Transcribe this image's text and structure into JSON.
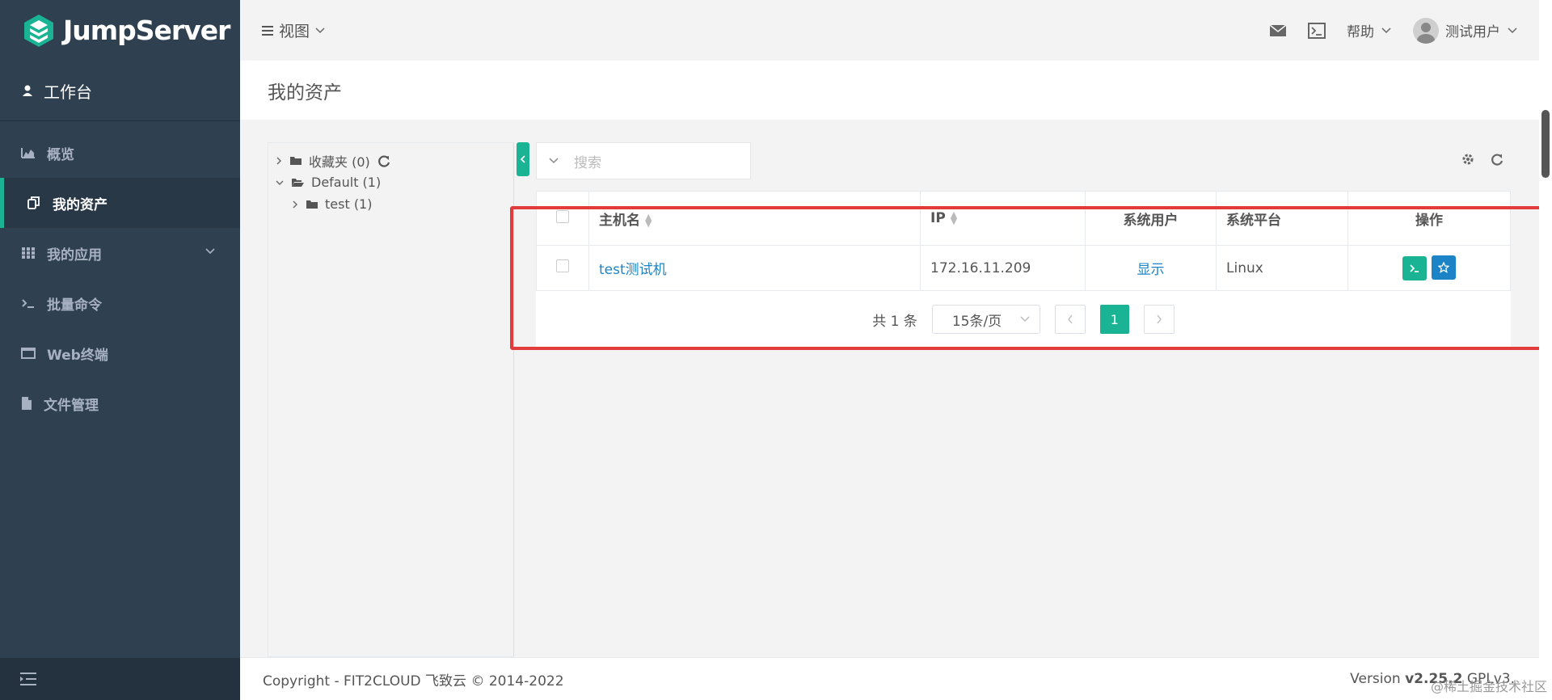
{
  "sidebar": {
    "logo": "JumpServer",
    "workbench": "工作台",
    "items": [
      {
        "label": "概览"
      },
      {
        "label": "我的资产"
      },
      {
        "label": "我的应用"
      },
      {
        "label": "批量命令"
      },
      {
        "label": "Web终端"
      },
      {
        "label": "文件管理"
      }
    ]
  },
  "topbar": {
    "view_menu": "视图",
    "help": "帮助",
    "user": "测试用户"
  },
  "page": {
    "title": "我的资产"
  },
  "tree": {
    "favorites": "收藏夹 (0)",
    "default": "Default (1)",
    "test": "test (1)"
  },
  "search": {
    "placeholder": "搜索"
  },
  "table": {
    "headers": [
      "主机名",
      "IP",
      "系统用户",
      "系统平台",
      "操作"
    ],
    "rows": [
      {
        "hostname": "test测试机",
        "ip": "172.16.11.209",
        "system_user": "显示",
        "platform": "Linux"
      }
    ]
  },
  "pager": {
    "total": "共 1 条",
    "page_size": "15条/页",
    "current": "1"
  },
  "footer": {
    "copyright": "Copyright - FIT2CLOUD 飞致云 © 2014-2022",
    "version_label": "Version",
    "version": "v2.25.2",
    "license": "GPLv3."
  },
  "watermark": "@稀土掘金技术社区",
  "colors": {
    "primary": "#1ab394",
    "link": "#1c84c6",
    "sidebar": "#2f4050",
    "highlight": "#e23b3b"
  }
}
